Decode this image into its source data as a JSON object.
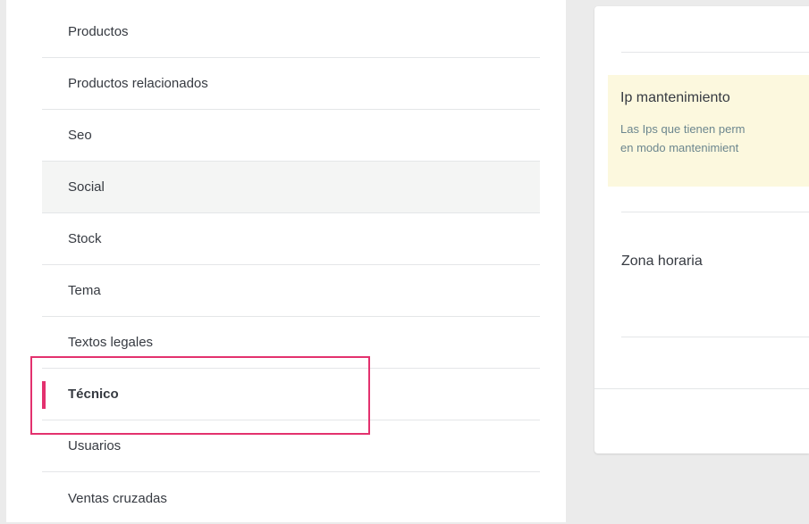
{
  "menu": {
    "items": [
      {
        "label": "Productos"
      },
      {
        "label": "Productos relacionados"
      },
      {
        "label": "Seo"
      },
      {
        "label": "Social"
      },
      {
        "label": "Stock"
      },
      {
        "label": "Tema"
      },
      {
        "label": "Textos legales"
      },
      {
        "label": "Técnico"
      },
      {
        "label": "Usuarios"
      },
      {
        "label": "Ventas cruzadas"
      }
    ],
    "active_item": "Técnico",
    "hovered_item": "Social"
  },
  "panel": {
    "maintenance_ip": {
      "title": "Ip mantenimiento",
      "text_line1": "Las Ips que tienen perm",
      "text_line2": "en modo mantenimient"
    },
    "timezone_label": "Zona horaria"
  },
  "colors": {
    "accent": "#e3316e",
    "notice_bg": "#fcf8de",
    "hover_bg": "#f4f5f4",
    "page_bg": "#ebebeb"
  }
}
